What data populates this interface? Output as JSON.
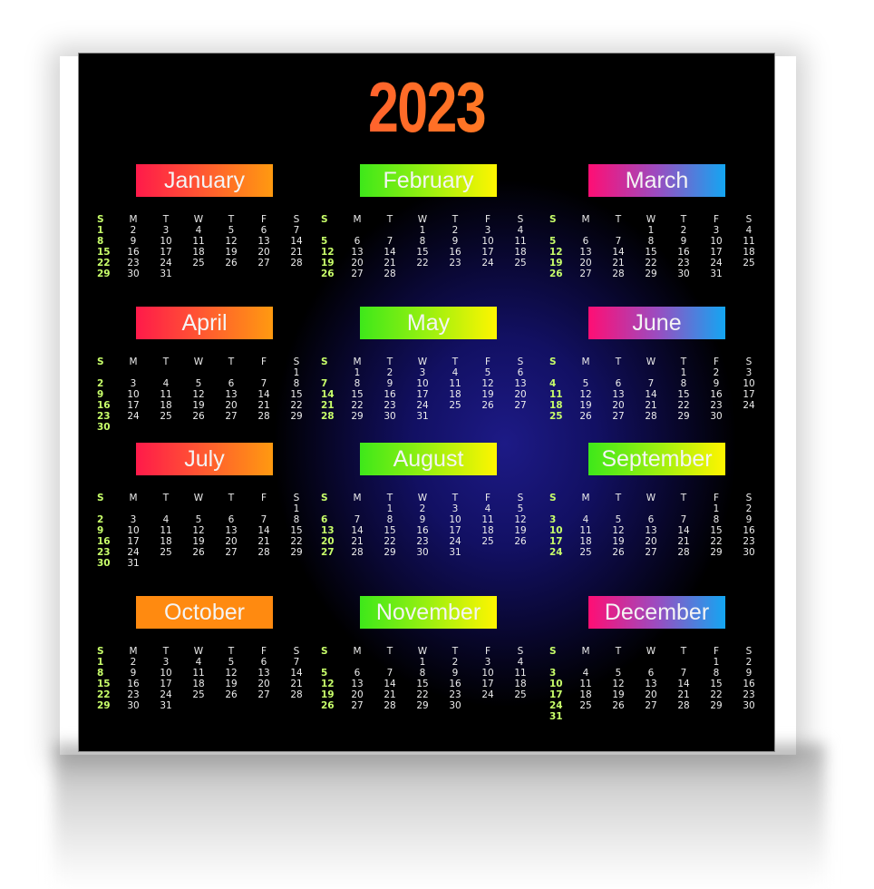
{
  "year": "2023",
  "weekday_headers": [
    "S",
    "M",
    "T",
    "W",
    "T",
    "F",
    "S"
  ],
  "colors": {
    "sunday_text": "#c8ff6a",
    "day_text": "#ececec",
    "year_gradient": [
      "#ff2d55",
      "#ff9a1a"
    ],
    "banner_warm": [
      "#ff1a4a",
      "#ff9a10"
    ],
    "banner_green": [
      "#3ee81a",
      "#fff500"
    ],
    "banner_pink_blue": [
      "#ff0e74",
      "#13a6f2"
    ]
  },
  "months": [
    {
      "name": "January",
      "style": "g1",
      "weeks": [
        [
          "1",
          "2",
          "3",
          "4",
          "5",
          "6",
          "7"
        ],
        [
          "8",
          "9",
          "10",
          "11",
          "12",
          "13",
          "14"
        ],
        [
          "15",
          "16",
          "17",
          "18",
          "19",
          "20",
          "21"
        ],
        [
          "22",
          "23",
          "24",
          "25",
          "26",
          "27",
          "28"
        ],
        [
          "29",
          "30",
          "31",
          "",
          "",
          "",
          ""
        ]
      ]
    },
    {
      "name": "February",
      "style": "g2",
      "weeks": [
        [
          "",
          "",
          "",
          "1",
          "2",
          "3",
          "4"
        ],
        [
          "5",
          "6",
          "7",
          "8",
          "9",
          "10",
          "11"
        ],
        [
          "12",
          "13",
          "14",
          "15",
          "16",
          "17",
          "18"
        ],
        [
          "19",
          "20",
          "21",
          "22",
          "23",
          "24",
          "25"
        ],
        [
          "26",
          "27",
          "28",
          "",
          "",
          "",
          ""
        ]
      ]
    },
    {
      "name": "March",
      "style": "g3",
      "weeks": [
        [
          "",
          "",
          "",
          "1",
          "2",
          "3",
          "4"
        ],
        [
          "5",
          "6",
          "7",
          "8",
          "9",
          "10",
          "11"
        ],
        [
          "12",
          "13",
          "14",
          "15",
          "16",
          "17",
          "18"
        ],
        [
          "19",
          "20",
          "21",
          "22",
          "23",
          "24",
          "25"
        ],
        [
          "26",
          "27",
          "28",
          "29",
          "30",
          "31",
          ""
        ]
      ]
    },
    {
      "name": "April",
      "style": "g1",
      "weeks": [
        [
          "",
          "",
          "",
          "",
          "",
          "",
          "1"
        ],
        [
          "2",
          "3",
          "4",
          "5",
          "6",
          "7",
          "8"
        ],
        [
          "9",
          "10",
          "11",
          "12",
          "13",
          "14",
          "15"
        ],
        [
          "16",
          "17",
          "18",
          "19",
          "20",
          "21",
          "22"
        ],
        [
          "23",
          "24",
          "25",
          "26",
          "27",
          "28",
          "29"
        ],
        [
          "30",
          "",
          "",
          "",
          "",
          "",
          ""
        ]
      ]
    },
    {
      "name": "May",
      "style": "g2",
      "weeks": [
        [
          "",
          "1",
          "2",
          "3",
          "4",
          "5",
          "6"
        ],
        [
          "7",
          "8",
          "9",
          "10",
          "11",
          "12",
          "13"
        ],
        [
          "14",
          "15",
          "16",
          "17",
          "18",
          "19",
          "20"
        ],
        [
          "21",
          "22",
          "23",
          "24",
          "25",
          "26",
          "27"
        ],
        [
          "28",
          "29",
          "30",
          "31",
          "",
          "",
          ""
        ]
      ]
    },
    {
      "name": "June",
      "style": "g3",
      "weeks": [
        [
          "",
          "",
          "",
          "",
          "1",
          "2",
          "3"
        ],
        [
          "4",
          "5",
          "6",
          "7",
          "8",
          "9",
          "10"
        ],
        [
          "11",
          "12",
          "13",
          "14",
          "15",
          "16",
          "17"
        ],
        [
          "18",
          "19",
          "20",
          "21",
          "22",
          "23",
          "24"
        ],
        [
          "25",
          "26",
          "27",
          "28",
          "29",
          "30",
          ""
        ]
      ]
    },
    {
      "name": "July",
      "style": "g1",
      "weeks": [
        [
          "",
          "",
          "",
          "",
          "",
          "",
          "1"
        ],
        [
          "2",
          "3",
          "4",
          "5",
          "6",
          "7",
          "8"
        ],
        [
          "9",
          "10",
          "11",
          "12",
          "13",
          "14",
          "15"
        ],
        [
          "16",
          "17",
          "18",
          "19",
          "20",
          "21",
          "22"
        ],
        [
          "23",
          "24",
          "25",
          "26",
          "27",
          "28",
          "29"
        ],
        [
          "30",
          "31",
          "",
          "",
          "",
          "",
          ""
        ]
      ]
    },
    {
      "name": "August",
      "style": "g2",
      "weeks": [
        [
          "",
          "",
          "1",
          "2",
          "3",
          "4",
          "5"
        ],
        [
          "6",
          "7",
          "8",
          "9",
          "10",
          "11",
          "12"
        ],
        [
          "13",
          "14",
          "15",
          "16",
          "17",
          "18",
          "19"
        ],
        [
          "20",
          "21",
          "22",
          "23",
          "24",
          "25",
          "26"
        ],
        [
          "27",
          "28",
          "29",
          "30",
          "31",
          "",
          ""
        ]
      ]
    },
    {
      "name": "September",
      "style": "g2",
      "weeks": [
        [
          "",
          "",
          "",
          "",
          "",
          "1",
          "2"
        ],
        [
          "3",
          "4",
          "5",
          "6",
          "7",
          "8",
          "9"
        ],
        [
          "10",
          "11",
          "12",
          "13",
          "14",
          "15",
          "16"
        ],
        [
          "17",
          "18",
          "19",
          "20",
          "21",
          "22",
          "23"
        ],
        [
          "24",
          "25",
          "26",
          "27",
          "28",
          "29",
          "30"
        ]
      ]
    },
    {
      "name": "October",
      "style": "g1o",
      "weeks": [
        [
          "1",
          "2",
          "3",
          "4",
          "5",
          "6",
          "7"
        ],
        [
          "8",
          "9",
          "10",
          "11",
          "12",
          "13",
          "14"
        ],
        [
          "15",
          "16",
          "17",
          "18",
          "19",
          "20",
          "21"
        ],
        [
          "22",
          "23",
          "24",
          "25",
          "26",
          "27",
          "28"
        ],
        [
          "29",
          "30",
          "31",
          "",
          "",
          "",
          ""
        ]
      ]
    },
    {
      "name": "November",
      "style": "g2",
      "weeks": [
        [
          "",
          "",
          "",
          "1",
          "2",
          "3",
          "4"
        ],
        [
          "5",
          "6",
          "7",
          "8",
          "9",
          "10",
          "11"
        ],
        [
          "12",
          "13",
          "14",
          "15",
          "16",
          "17",
          "18"
        ],
        [
          "19",
          "20",
          "21",
          "22",
          "23",
          "24",
          "25"
        ],
        [
          "26",
          "27",
          "28",
          "29",
          "30",
          "",
          ""
        ]
      ]
    },
    {
      "name": "December",
      "style": "g3",
      "weeks": [
        [
          "",
          "",
          "",
          "",
          "",
          "1",
          "2"
        ],
        [
          "3",
          "4",
          "5",
          "6",
          "7",
          "8",
          "9"
        ],
        [
          "10",
          "11",
          "12",
          "13",
          "14",
          "15",
          "16"
        ],
        [
          "17",
          "18",
          "19",
          "20",
          "21",
          "22",
          "23"
        ],
        [
          "24",
          "25",
          "26",
          "27",
          "28",
          "29",
          "30"
        ],
        [
          "31",
          "",
          "",
          "",
          "",
          "",
          ""
        ]
      ]
    }
  ]
}
